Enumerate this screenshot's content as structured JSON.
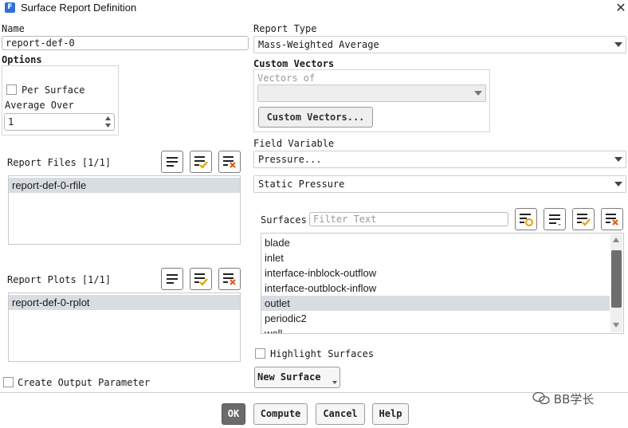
{
  "window": {
    "title": "Surface Report Definition",
    "app_icon": "F"
  },
  "name": {
    "label": "Name",
    "value": "report-def-0"
  },
  "options": {
    "label": "Options",
    "per_surface_label": "Per Surface",
    "average_over_label": "Average Over",
    "average_over_value": "1"
  },
  "report_type": {
    "label": "Report Type",
    "value": "Mass-Weighted Average"
  },
  "custom_vectors": {
    "label": "Custom Vectors",
    "vectors_of_label": "Vectors of",
    "vectors_of_value": "",
    "button_label": "Custom Vectors..."
  },
  "report_files": {
    "label": "Report Files [1/1]",
    "items": [
      "report-def-0-rfile"
    ]
  },
  "report_plots": {
    "label": "Report Plots [1/1]",
    "items": [
      "report-def-0-rplot"
    ]
  },
  "field_variable": {
    "label": "Field Variable",
    "category": "Pressure...",
    "value": "Static Pressure"
  },
  "surfaces": {
    "label": "Surfaces",
    "filter_placeholder": "Filter Text",
    "items": [
      "blade",
      "inlet",
      "interface-inblock-outflow",
      "interface-outblock-inflow",
      "outlet",
      "periodic2",
      "wall"
    ],
    "selected": "outlet"
  },
  "highlight_surfaces_label": "Highlight Surfaces",
  "new_surface_label": "New Surface",
  "create_output_parameter_label": "Create Output Parameter",
  "buttons": {
    "ok": "OK",
    "compute": "Compute",
    "cancel": "Cancel",
    "help": "Help"
  },
  "watermark": "BB学长",
  "colors": {
    "selection": "#d8dde4",
    "primary_button": "#6b6b6b",
    "check_accent": "#e8a100",
    "cross_accent": "#e06010"
  }
}
